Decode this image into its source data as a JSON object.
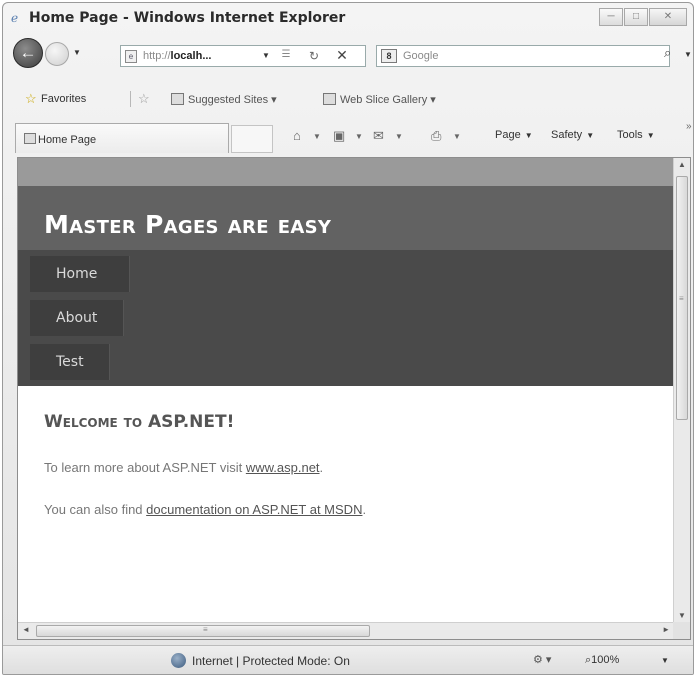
{
  "window": {
    "title": "Home Page - Windows Internet Explorer",
    "controls": [
      "─",
      "□",
      "✕"
    ]
  },
  "address_bar": {
    "url_prefix": "http://",
    "url_host": "localh...",
    "search_placeholder": "Google"
  },
  "favorites_bar": {
    "favorites_label": "Favorites",
    "items": [
      "Suggested Sites ▾",
      "Web Slice Gallery ▾"
    ]
  },
  "tab": {
    "label": "Home Page"
  },
  "command_bar": {
    "page": "Page",
    "safety": "Safety",
    "tools": "Tools"
  },
  "site": {
    "title": "Master Pages are easy",
    "menu": [
      "Home",
      "About",
      "Test"
    ],
    "welcome": "Welcome to ASP.NET!",
    "p1_text": "To learn more about ASP.NET visit ",
    "p1_link": "www.asp.net",
    "p1_end": ".",
    "p2_text": "You can also find ",
    "p2_link": "documentation on ASP.NET at MSDN",
    "p2_end": "."
  },
  "status_bar": {
    "zone": "Internet | Protected Mode: On",
    "zoom": "⌕100%"
  },
  "icons": {
    "back": "←",
    "refresh": "↻",
    "stop": "✕",
    "search": "⌕",
    "star": "☆",
    "home": "⌂",
    "print": "⎙"
  }
}
